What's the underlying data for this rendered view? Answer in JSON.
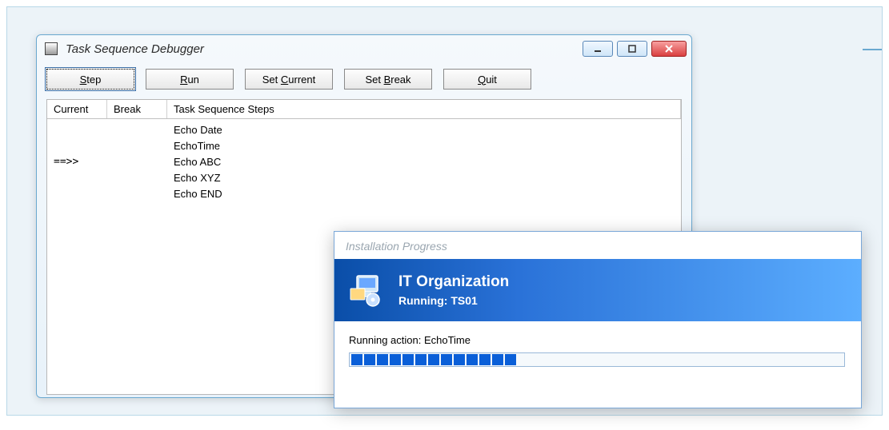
{
  "debugger": {
    "title": "Task Sequence Debugger",
    "buttons": {
      "step": "Step",
      "run": "Run",
      "set_current": "Set Current",
      "set_break": "Set Break",
      "quit": "Quit"
    },
    "columns": {
      "current": "Current",
      "break": "Break",
      "steps": "Task Sequence Steps"
    },
    "rows": [
      {
        "current": "",
        "break": "",
        "step": "Echo Date"
      },
      {
        "current": "",
        "break": "",
        "step": "EchoTime"
      },
      {
        "current": "==>>",
        "break": "",
        "step": "Echo ABC"
      },
      {
        "current": "",
        "break": "",
        "step": "Echo XYZ"
      },
      {
        "current": "",
        "break": "",
        "step": "Echo END"
      }
    ]
  },
  "progress": {
    "title": "Installation Progress",
    "org": "IT Organization",
    "running_prefix": "Running: ",
    "running_name": "TS01",
    "action_prefix": "Running action: ",
    "action_name": "EchoTime",
    "segments_filled": 13,
    "segments_total": 40
  }
}
